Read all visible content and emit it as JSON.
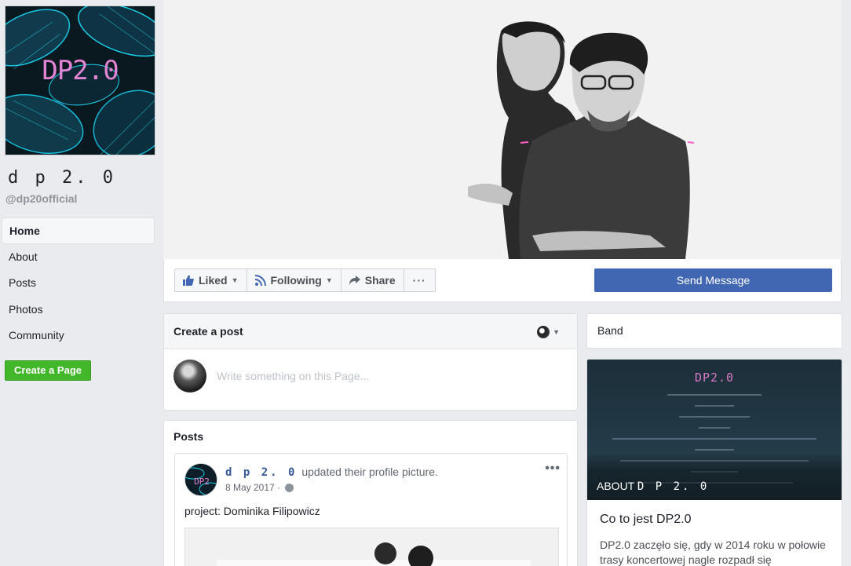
{
  "page": {
    "name": "d p 2. 0",
    "handle": "@dp20official",
    "logo_text": "DP2.0"
  },
  "nav": {
    "items": [
      "Home",
      "About",
      "Posts",
      "Photos",
      "Community"
    ],
    "create_page": "Create a Page"
  },
  "actions": {
    "liked": "Liked",
    "following": "Following",
    "share": "Share",
    "more": "···",
    "send_message": "Send Message"
  },
  "create_post": {
    "title": "Create a post",
    "placeholder": "Write something on this Page..."
  },
  "posts": {
    "title": "Posts",
    "items": [
      {
        "author": "d p 2. 0",
        "action": "updated their profile picture.",
        "date": "8 May 2017 ·",
        "text": "project: Dominika Filipowicz",
        "more": "•••"
      }
    ]
  },
  "sidebar": {
    "category": "Band",
    "about": {
      "image_logo": "DP2.0",
      "caption_prefix": "ABOUT",
      "caption_name": "D P 2. 0",
      "title": "Co to jest DP2.0",
      "description": "DP2.0 zaczęło się, gdy w 2014 roku w połowie trasy koncertowej nagle rozpadł się"
    }
  },
  "colors": {
    "facebook_blue": "#4267b2",
    "create_green": "#42b72a",
    "link_blue": "#365899",
    "logo_pink": "#e284d4",
    "leaf_cyan": "#12c8e6"
  }
}
